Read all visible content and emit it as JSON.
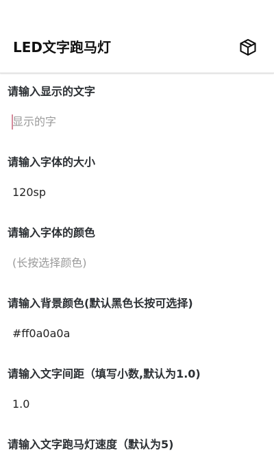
{
  "appbar": {
    "title": "LED文字跑马灯",
    "action_icon": "package-icon"
  },
  "form": {
    "fields": [
      {
        "label": "请输入显示的文字",
        "value": "",
        "placeholder": "显示的字"
      },
      {
        "label": "请输入字体的大小",
        "value": "120sp",
        "placeholder": ""
      },
      {
        "label": "请输入字体的颜色",
        "value": "",
        "placeholder": "(长按选择颜色)"
      },
      {
        "label": "请输入背景颜色(默认黑色长按可选择)",
        "value": "#ff0a0a0a",
        "placeholder": ""
      },
      {
        "label": "请输入文字间距（填写小数,默认为1.0)",
        "value": "1.0",
        "placeholder": ""
      },
      {
        "label": "请输入文字跑马灯速度（默认为5)",
        "value": "",
        "placeholder": ""
      }
    ]
  },
  "colors": {
    "cursor": "#d4899a",
    "placeholder": "#9a9a9a",
    "divider": "#d8d8d8"
  }
}
